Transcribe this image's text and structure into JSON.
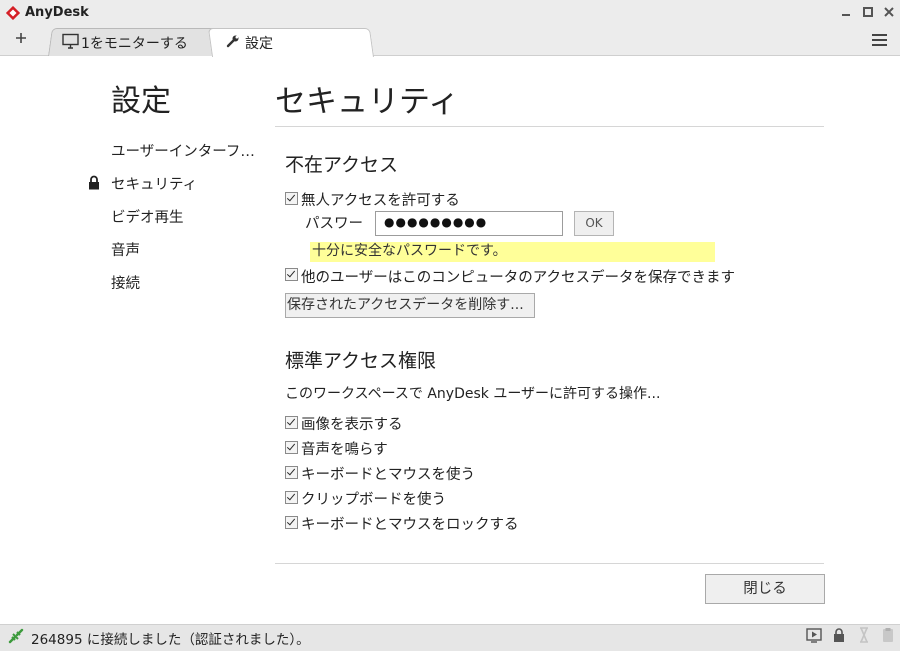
{
  "window": {
    "app_title": "AnyDesk",
    "brand_color": "#d51f26"
  },
  "tabs": [
    {
      "label": "1をモニターする",
      "icon": "monitor-icon"
    },
    {
      "label": "設定",
      "icon": "wrench-icon",
      "active": true
    }
  ],
  "sidebar": {
    "heading": "設定",
    "items": [
      {
        "label": "ユーザーインターフ…"
      },
      {
        "label": "セキュリティ",
        "icon": "lock-icon",
        "active": true
      },
      {
        "label": "ビデオ再生"
      },
      {
        "label": "音声"
      },
      {
        "label": "接続"
      }
    ]
  },
  "main": {
    "title": "セキュリティ",
    "unattended": {
      "heading": "不在アクセス",
      "allow_label": "無人アクセスを許可する",
      "allow_checked": true,
      "password_label": "パスワード:",
      "password_value": "●●●●●●●●●",
      "ok_label": "OK",
      "password_hint": "十分に安全なパスワードです。",
      "save_data_label": "他のユーザーはこのコンピュータのアクセスデータを保存できます",
      "save_data_checked": true,
      "delete_button": "保存されたアクセスデータを削除す..."
    },
    "permissions": {
      "heading": "標準アクセス権限",
      "description": "このワークスペースで AnyDesk ユーザーに許可する操作...",
      "items": [
        {
          "label": "画像を表示する",
          "checked": true
        },
        {
          "label": "音声を鳴らす",
          "checked": true
        },
        {
          "label": "キーボードとマウスを使う",
          "checked": true
        },
        {
          "label": "クリップボードを使う",
          "checked": true
        },
        {
          "label": "キーボードとマウスをロックする",
          "checked": true
        }
      ]
    },
    "close_button": "閉じる"
  },
  "status": {
    "text": "264895 に接続しました（認証されました）。",
    "icon_color": "#3c9a3c"
  }
}
